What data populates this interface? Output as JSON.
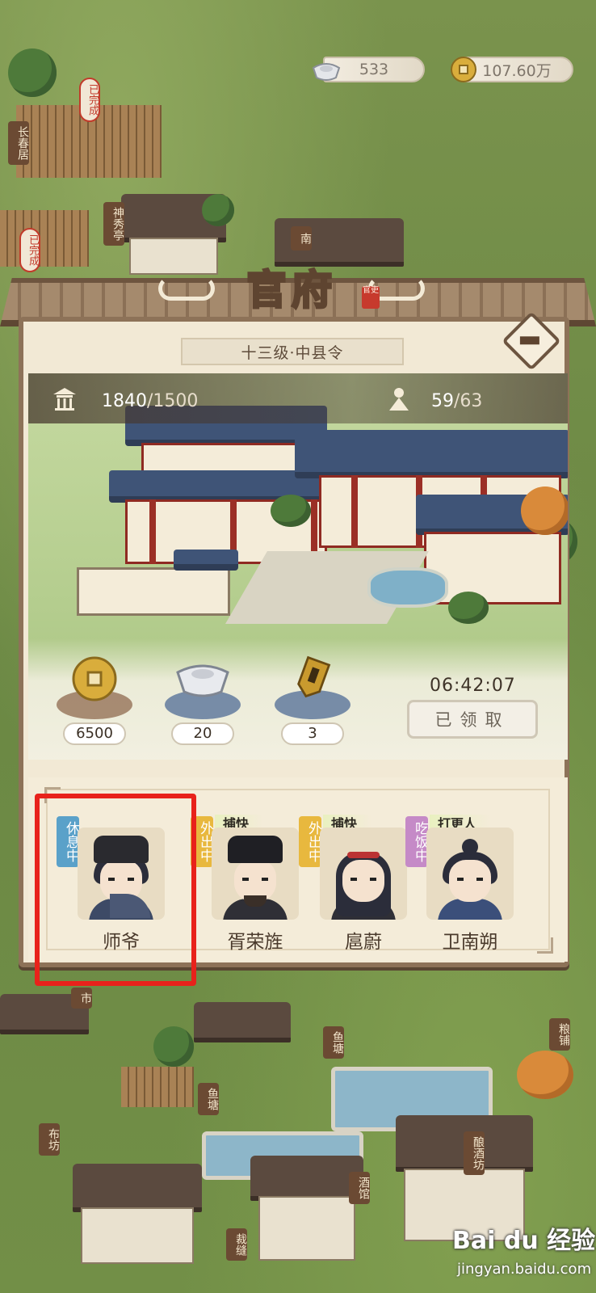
{
  "resources": {
    "silver": {
      "icon": "silver-ingot-icon",
      "value": "533"
    },
    "copper": {
      "icon": "copper-coin-icon",
      "value": "107.60万"
    }
  },
  "town_labels": {
    "changchun": "长春居",
    "shenxiu": "神秀亭",
    "nan": "南",
    "done1": "已完成",
    "done2": "已完成",
    "shi": "市",
    "yutang1": "鱼塘",
    "yutang2": "鱼塘",
    "liangpu": "粮铺",
    "bufang": "布坊",
    "jiuguan": "酒馆",
    "niangjiufang": "酿酒坊",
    "caifeng": "裁缝"
  },
  "panel": {
    "title": "官府",
    "seal": "官吏",
    "rank": "十三级·中县令",
    "building_capacity": {
      "current": "1840",
      "max": "/1500",
      "icon": "pavilion-icon"
    },
    "population": {
      "current": "59",
      "max": "/63",
      "icon": "person-icon"
    },
    "rewards": [
      {
        "icon": "copper-coin-icon",
        "qty": "6500"
      },
      {
        "icon": "silver-ingot-icon",
        "qty": "20"
      },
      {
        "icon": "token-tablet-icon",
        "qty": "3"
      }
    ],
    "timer": "06:42:07",
    "claim_button": "已领取",
    "staff": [
      {
        "name": "师爷",
        "status": "休息中",
        "status_color": "#5aa1c9",
        "role": ""
      },
      {
        "name": "胥荣旌",
        "status": "外出中",
        "status_color": "#e8b83e",
        "role": "捕快"
      },
      {
        "name": "扈蔚",
        "status": "外出中",
        "status_color": "#e8b83e",
        "role": "捕快"
      },
      {
        "name": "卫南朔",
        "status": "吃饭中",
        "status_color": "#c58ac7",
        "role": "打更人"
      }
    ]
  },
  "watermark": {
    "brand": "Bai du 经验",
    "url": "jingyan.baidu.com"
  },
  "colors": {
    "highlight": "#e8221b",
    "panel_bg": "#f2e9d5",
    "frame": "#8d7258"
  }
}
